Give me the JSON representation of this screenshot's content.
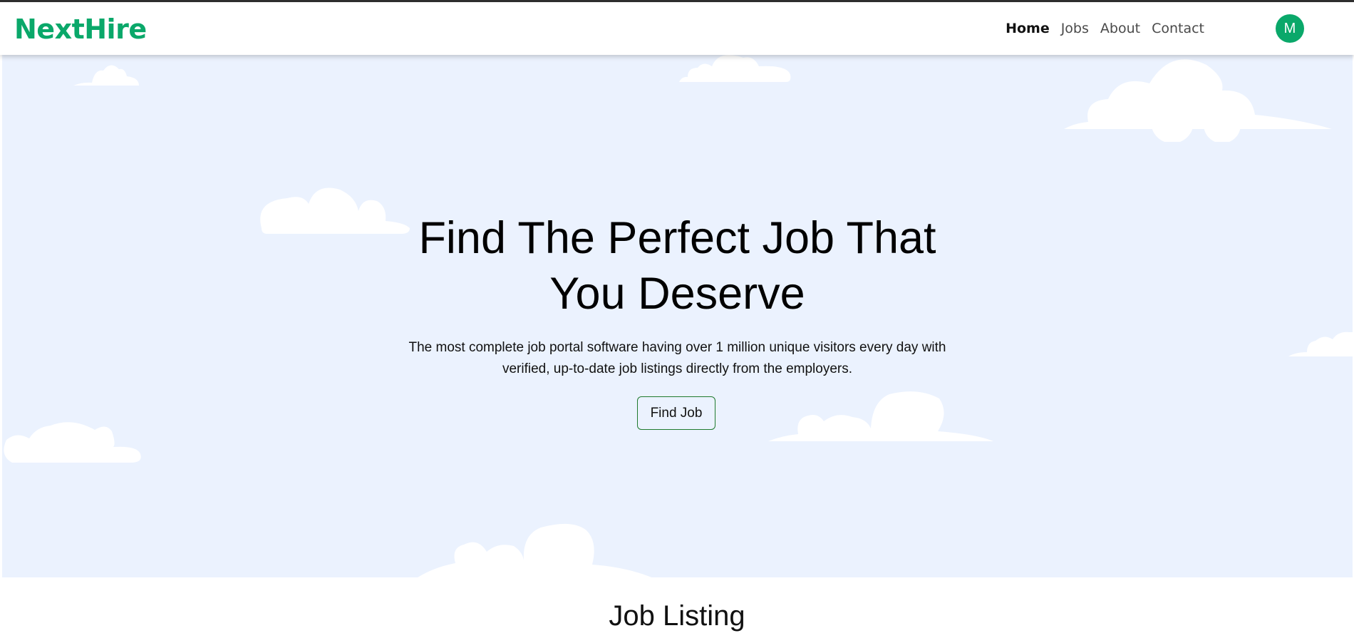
{
  "navbar": {
    "brand": "NextHire",
    "links": [
      {
        "label": "Home",
        "active": true
      },
      {
        "label": "Jobs",
        "active": false
      },
      {
        "label": "About",
        "active": false
      },
      {
        "label": "Contact",
        "active": false
      }
    ],
    "avatar_initial": "M"
  },
  "hero": {
    "title_line1": "Find The Perfect Job That",
    "title_line2": "You Deserve",
    "subtitle_line1": "The most complete job portal software having over 1 million unique visitors every day with",
    "subtitle_line2": "verified, up-to-date job listings directly from the employers.",
    "cta_label": "Find Job"
  },
  "sections": {
    "job_listing_title": "Job Listing"
  },
  "colors": {
    "brand": "#0aa86a",
    "hero_background": "#ebf2fe",
    "button_border": "#1f7a2e"
  }
}
